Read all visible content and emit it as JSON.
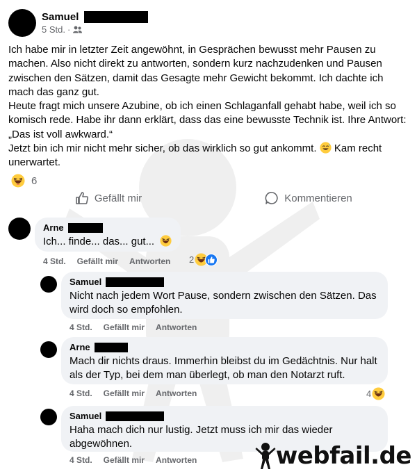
{
  "post": {
    "author": "Samuel",
    "time": "5 Std.",
    "separator": "·",
    "audience_icon": "friends-icon",
    "paragraphs": [
      "Ich habe mir in letzter Zeit angewöhnt, in Gesprächen bewusst mehr Pausen zu machen. Also nicht direkt zu antworten, sondern kurz nachzudenken und Pausen zwischen den Sätzen, damit das Gesagte mehr Gewicht bekommt. Ich dachte ich mach das ganz gut.",
      "Heute fragt mich unsere Azubine, ob ich einen Schlaganfall gehabt habe, weil ich so komisch rede. Habe ihr dann erklärt, dass das eine bewusste Technik ist. Ihre Antwort: „Das ist voll awkward.“"
    ],
    "last_line_before": "Jetzt bin ich mir nicht mehr sicher, ob das wirklich so gut ankommt.",
    "last_line_after": "Kam recht unerwartet.",
    "reaction_count": "6",
    "like_label": "Gefällt mir",
    "comment_label": "Kommentieren"
  },
  "comments": [
    {
      "author": "Arne",
      "text": "Ich... finde... das... gut...",
      "time": "4 Std.",
      "like": "Gefällt mir",
      "reply": "Antworten",
      "reactions": "2"
    },
    {
      "author": "Samuel",
      "text": "Nicht nach jedem Wort Pause, sondern zwischen den Sätzen. Das wird doch so empfohlen.",
      "time": "4 Std.",
      "like": "Gefällt mir",
      "reply": "Antworten"
    },
    {
      "author": "Arne",
      "text": "Mach dir nichts draus. Immerhin bleibst du im Gedächtnis. Nur halt als der Typ, bei dem man überlegt, ob man den Notarzt ruft.",
      "time": "4 Std.",
      "like": "Gefällt mir",
      "reply": "Antworten",
      "reactions": "4"
    },
    {
      "author": "Samuel",
      "text": "Haha mach dich nur lustig. Jetzt muss ich mir das wieder abgewöhnen.",
      "time": "4 Std.",
      "like": "Gefällt mir",
      "reply": "Antworten"
    }
  ],
  "watermark": {
    "text": "webfail.de"
  },
  "colors": {
    "meta": "#65676b",
    "bubble": "#f0f2f5",
    "like_blue": "#1877f2",
    "emoji_yellow": "#ffcc3e"
  }
}
